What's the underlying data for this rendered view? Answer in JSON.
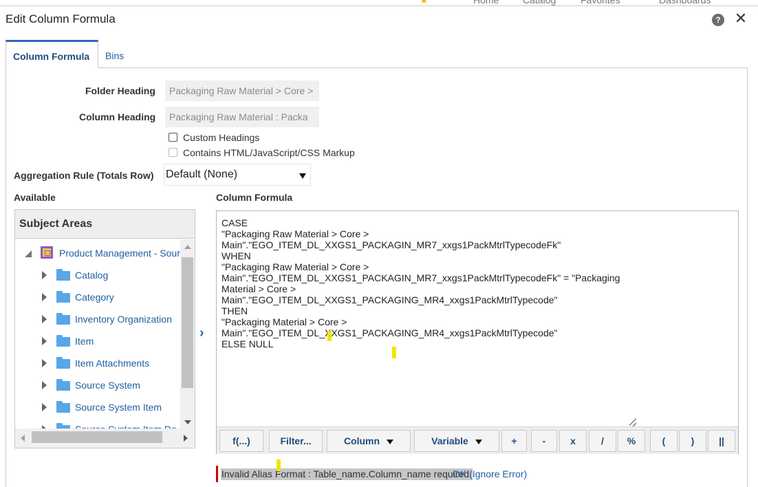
{
  "background_nav": {
    "items": [
      "Home",
      "Catalog",
      "Favorites",
      "Dashboards"
    ]
  },
  "dialog": {
    "title": "Edit Column Formula",
    "help_icon": "help-icon",
    "close_icon": "close-icon",
    "help_glyph": "?",
    "close_glyph": "✕"
  },
  "tabs": [
    {
      "label": "Column Formula",
      "active": true
    },
    {
      "label": "Bins",
      "active": false
    }
  ],
  "headings": {
    "folder_label": "Folder Heading",
    "folder_value": "Packaging Raw Material > Core > ",
    "column_label": "Column Heading",
    "column_value": "Packaging Raw Material :  Packa"
  },
  "checkboxes": {
    "custom_headings": {
      "label": "Custom Headings",
      "checked": false
    },
    "contains_markup": {
      "label": "Contains HTML/JavaScript/CSS Markup",
      "checked": false,
      "disabled": true
    }
  },
  "aggregation": {
    "label": "Aggregation Rule (Totals Row)",
    "value": "Default (None)"
  },
  "available": {
    "label": "Available",
    "header": "Subject Areas",
    "root": "Product Management - Sour",
    "folders": [
      "Catalog",
      "Category",
      "Inventory Organization",
      "Item",
      "Item Attachments",
      "Source System",
      "Source System Item",
      "Source System Item De"
    ]
  },
  "formula": {
    "label": "Column Formula",
    "text": "CASE\n\"Packaging Raw Material > Core >\nMain\".\"EGO_ITEM_DL_XXGS1_PACKAGIN_MR7_xxgs1PackMtrlTypecodeFk\"\nWHEN\n\"Packaging Raw Material > Core >\nMain\".\"EGO_ITEM_DL_XXGS1_PACKAGIN_MR7_xxgs1PackMtrlTypecodeFk\" = \"Packaging\nMaterial > Core >\nMain\".\"EGO_ITEM_DL_XXGS1_PACKAGING_MR4_xxgs1PackMtrlTypecode\"\nTHEN\n\"Packaging Material > Core >\nMain\".\"EGO_ITEM_DL_XXGS1_PACKAGING_MR4_xxgs1PackMtrlTypecode\"\nELSE NULL",
    "toolbar": {
      "function": "f(...)",
      "filter": "Filter...",
      "column": "Column",
      "variable": "Variable",
      "plus": "+",
      "minus": "-",
      "times": "x",
      "divide": "/",
      "percent": "%",
      "lparen": "(",
      "rparen": ")",
      "concat": "||"
    }
  },
  "error": {
    "message": "Invalid Alias Format : Table_name.Column_name required.",
    "link": "OK (Ignore Error)"
  },
  "colors": {
    "accent": "#2b67b5",
    "link": "#1f5fa0",
    "error": "#cc0000",
    "highlight": "#f3e400"
  }
}
